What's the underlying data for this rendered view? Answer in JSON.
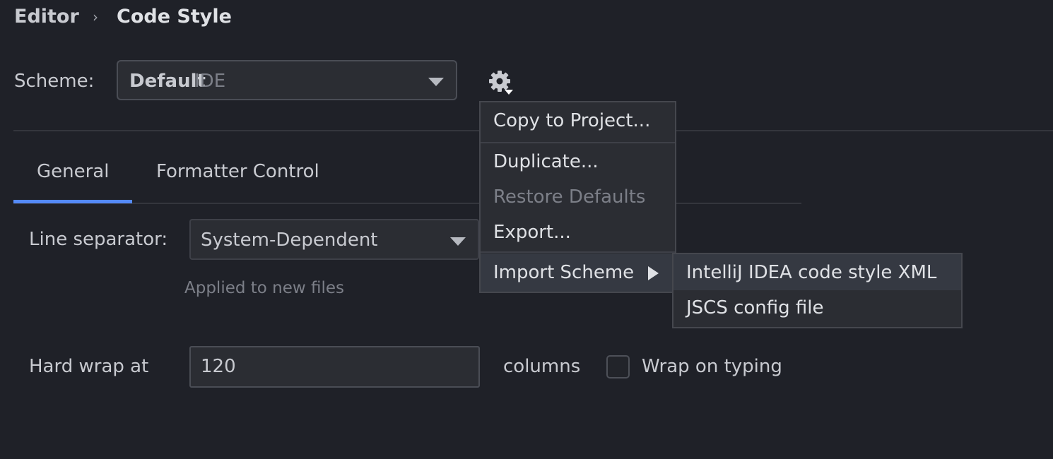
{
  "breadcrumb": {
    "parent": "Editor",
    "separator": "›",
    "current": "Code Style"
  },
  "scheme": {
    "label": "Scheme:",
    "selected_name": "Default",
    "selected_kind": "IDE"
  },
  "settings_icon": "gear-icon",
  "tabs": [
    {
      "label": "General",
      "active": true
    },
    {
      "label": "Formatter Control",
      "active": false
    }
  ],
  "general": {
    "line_separator": {
      "label": "Line separator:",
      "value": "System-Dependent",
      "hint": "Applied to new files"
    },
    "hard_wrap": {
      "label": "Hard wrap at",
      "value": "120",
      "unit": "columns"
    },
    "wrap_on_typing": {
      "label": "Wrap on typing",
      "checked": false
    }
  },
  "gear_menu": {
    "items": [
      {
        "label": "Copy to Project...",
        "enabled": true
      },
      {
        "label": "Duplicate...",
        "enabled": true
      },
      {
        "label": "Restore Defaults",
        "enabled": false
      },
      {
        "label": "Export...",
        "enabled": true
      },
      {
        "label": "Import Scheme",
        "enabled": true,
        "has_submenu": true,
        "highlighted": true
      }
    ]
  },
  "import_submenu": {
    "items": [
      {
        "label": "IntelliJ IDEA code style XML",
        "highlighted": true
      },
      {
        "label": "JSCS config file",
        "highlighted": false
      }
    ]
  },
  "colors": {
    "background": "#1f2128",
    "control_background": "#2b2d33",
    "accent": "#548af7",
    "text": "#dfe1e5",
    "muted_text": "#7c7f88"
  }
}
